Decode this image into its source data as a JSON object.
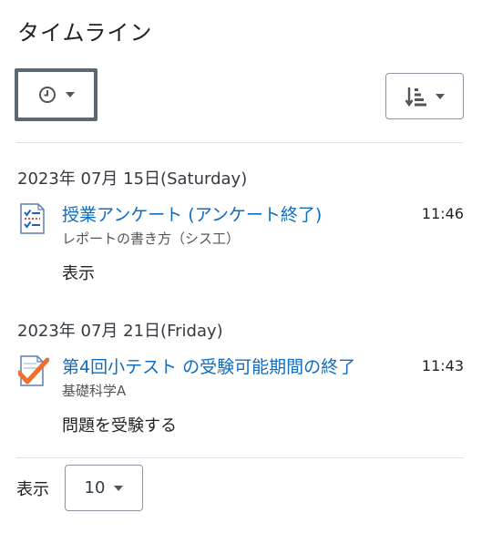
{
  "header": {
    "title": "タイムライン"
  },
  "controls": {
    "filter_icon": "clock-icon",
    "sort_icon": "sort-descending-icon",
    "page_size_label": "表示",
    "page_size_value": "10"
  },
  "groups": [
    {
      "date": "2023年 07月 15日(Saturday)",
      "events": [
        {
          "icon": "feedback-icon",
          "name": "授業アンケート (アンケート終了)",
          "time": "11:46",
          "course": "レポートの書き方（シス工）",
          "action": "表示"
        }
      ]
    },
    {
      "date": "2023年 07月 21日(Friday)",
      "events": [
        {
          "icon": "quiz-icon",
          "name": "第4回小テスト の受験可能期間の終了",
          "time": "11:43",
          "course": "基礎科学A",
          "action": "問題を受験する"
        }
      ]
    }
  ],
  "colors": {
    "link": "#0f6cbf",
    "divider": "#dee2e6",
    "quiz_check": "#f0702b"
  }
}
